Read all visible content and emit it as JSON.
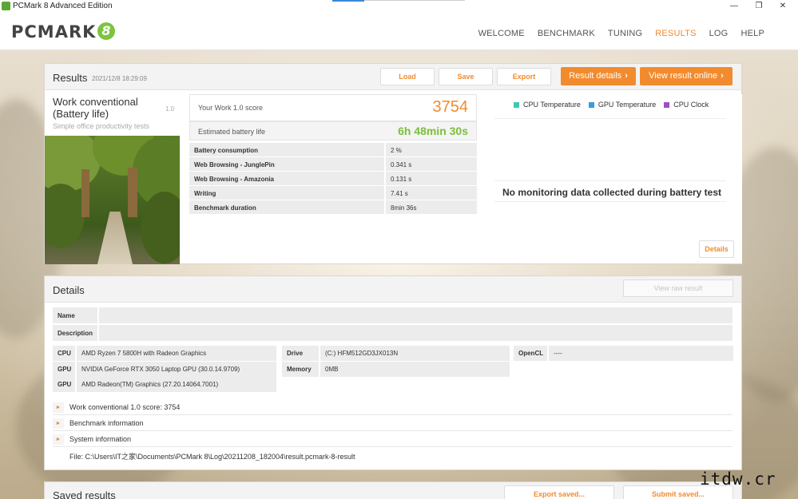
{
  "window": {
    "title": "PCMark 8 Advanced Edition",
    "controls": [
      "—",
      "❐",
      "✕"
    ]
  },
  "header": {
    "logo_text": "PCMARK",
    "logo_mark": "8",
    "nav": [
      "WELCOME",
      "BENCHMARK",
      "TUNING",
      "RESULTS",
      "LOG",
      "HELP"
    ],
    "active_nav": "RESULTS"
  },
  "results": {
    "title": "Results",
    "timestamp": "2021/12/8 18:29:09",
    "buttons": {
      "load": "Load",
      "save": "Save",
      "export": "Export",
      "result_details": "Result details",
      "view_online": "View result online",
      "chevron": "›"
    },
    "test": {
      "name": "Work conventional (Battery life)",
      "version": "1.0",
      "description": "Simple office productivity tests"
    },
    "score_label": "Your Work 1.0 score",
    "score_value": "3754",
    "battery_label": "Estimated battery life",
    "battery_value": "6h 48min 30s",
    "metrics": [
      {
        "name": "Battery consumption",
        "value": "2 %"
      },
      {
        "name": "Web Browsing - JunglePin",
        "value": "0.341 s"
      },
      {
        "name": "Web Browsing - Amazonia",
        "value": "0.131 s"
      },
      {
        "name": "Writing",
        "value": "7.41 s"
      },
      {
        "name": "Benchmark duration",
        "value": "8min 36s"
      }
    ],
    "monitoring": {
      "legend": [
        {
          "label": "CPU Temperature",
          "color": "#3ec8b4"
        },
        {
          "label": "GPU Temperature",
          "color": "#3a9bd9"
        },
        {
          "label": "CPU Clock",
          "color": "#9b4fc4"
        }
      ],
      "message": "No monitoring data collected during battery test",
      "details_button": "Details"
    }
  },
  "details": {
    "title": "Details",
    "view_raw": "View raw result",
    "name_key": "Name",
    "name_value": "",
    "description_key": "Description",
    "description_value": "",
    "system": {
      "cpu_key": "CPU",
      "cpu": "AMD Ryzen 7 5800H with Radeon Graphics",
      "gpu_key": "GPU",
      "gpu1": "NVIDIA GeForce RTX 3050 Laptop GPU (30.0.14.9709)",
      "gpu2": "AMD Radeon(TM) Graphics (27.20.14064.7001)",
      "drive_key": "Drive",
      "drive": "(C:) HFM512GD3JX013N",
      "memory_key": "Memory",
      "memory": "0MB",
      "opencl_key": "OpenCL",
      "opencl": "----"
    },
    "expanders": [
      "Work conventional 1.0 score: 3754",
      "Benchmark information",
      "System information"
    ],
    "file_path": "File: C:\\Users\\IT之家\\Documents\\PCMark 8\\Log\\20211208_182004\\result.pcmark-8-result"
  },
  "saved": {
    "title": "Saved results",
    "export_saved": "Export saved...",
    "submit_saved": "Submit saved..."
  },
  "colors": {
    "accent": "#f28b2e",
    "battery_green": "#7cbf3a"
  },
  "watermark": "itdw.cr"
}
